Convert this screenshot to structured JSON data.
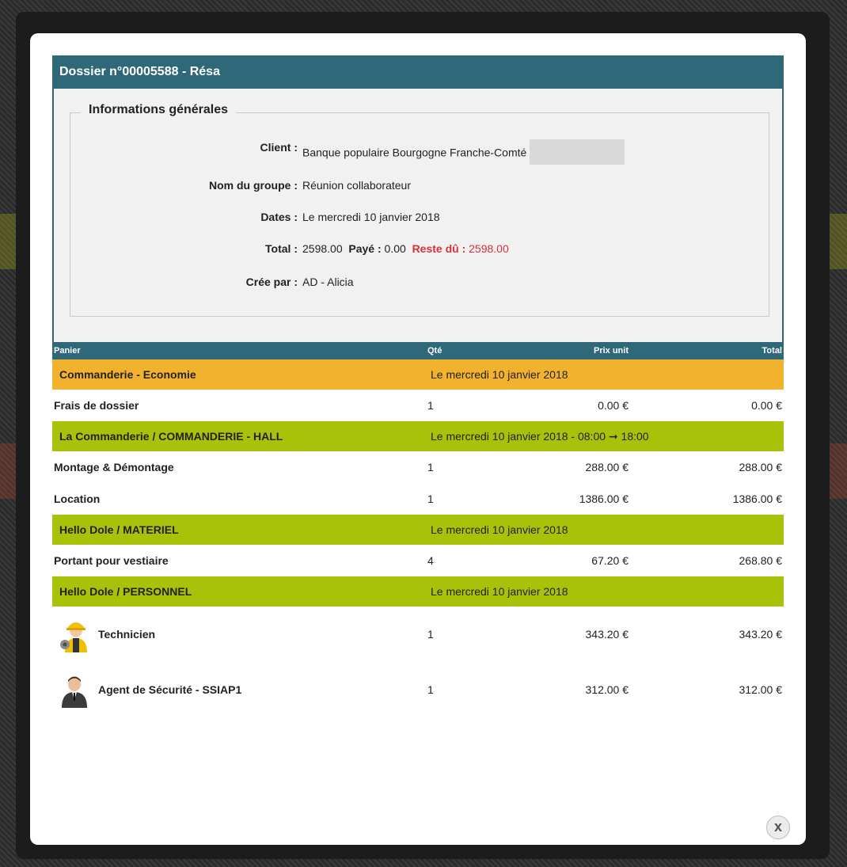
{
  "dossier": {
    "title": "Dossier n°00005588 - Résa"
  },
  "info": {
    "legend": "Informations générales",
    "client_label": "Client :",
    "client_value": "Banque populaire Bourgogne Franche-Comté",
    "group_label": "Nom du groupe :",
    "group_value": "Réunion collaborateur",
    "dates_label": "Dates :",
    "dates_value": "Le mercredi 10 janvier 2018",
    "total_label": "Total :",
    "total_value": "2598.00",
    "paid_label": "Payé :",
    "paid_value": "0.00",
    "remaining_label": "Reste dû :",
    "remaining_value": "2598.00",
    "created_label": "Crée par :",
    "created_value": "AD - Alicia"
  },
  "cart": {
    "headers": {
      "panier": "Panier",
      "qty": "Qté",
      "unit": "Prix unit",
      "total": "Total"
    },
    "groups": [
      {
        "name": "Commanderie - Economie",
        "date": "Le mercredi 10 janvier 2018",
        "color": "#f2b22e",
        "items": [
          {
            "name": "Frais de dossier",
            "qty": "1",
            "unit": "0.00 €",
            "total": "0.00 €"
          }
        ]
      },
      {
        "name": "La Commanderie / COMMANDERIE - HALL",
        "date": "Le mercredi 10 janvier 2018 - 08:00 ➞ 18:00",
        "color": "#a8c20a",
        "items": [
          {
            "name": "Montage & Démontage",
            "qty": "1",
            "unit": "288.00 €",
            "total": "288.00 €"
          },
          {
            "name": "Location",
            "qty": "1",
            "unit": "1386.00 €",
            "total": "1386.00 €"
          }
        ]
      },
      {
        "name": "Hello Dole / MATERIEL",
        "date": "Le mercredi 10 janvier 2018",
        "color": "#a8c20a",
        "items": [
          {
            "name": "Portant pour vestiaire",
            "qty": "4",
            "unit": "67.20 €",
            "total": "268.80 €"
          }
        ]
      },
      {
        "name": "Hello Dole / PERSONNEL",
        "date": "Le mercredi 10 janvier 2018",
        "color": "#a8c20a",
        "items": [
          {
            "name": "Technicien",
            "qty": "1",
            "unit": "343.20 €",
            "total": "343.20 €",
            "icon": "technician-icon"
          },
          {
            "name": "Agent de Sécurité - SSIAP1",
            "qty": "1",
            "unit": "312.00 €",
            "total": "312.00 €",
            "icon": "security-agent-icon"
          }
        ]
      }
    ]
  },
  "close": {
    "label": "x"
  }
}
